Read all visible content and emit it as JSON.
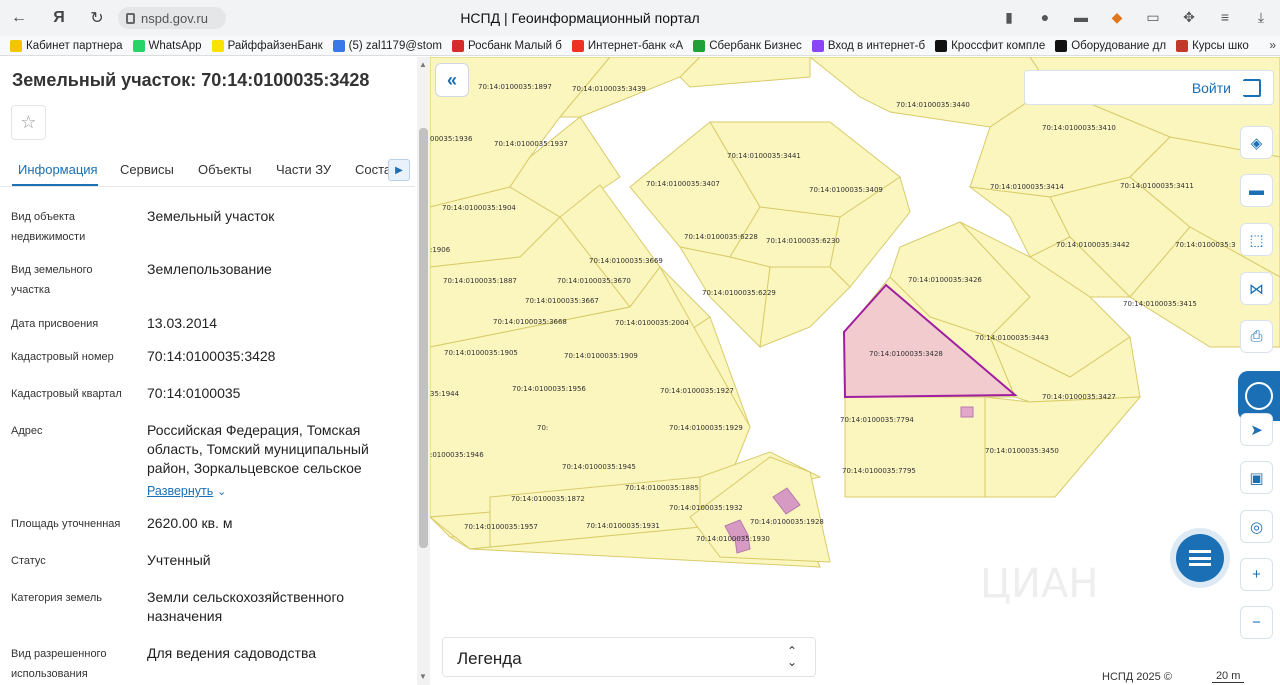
{
  "browser": {
    "url": "nspd.gov.ru",
    "page_title": "НСПД | Геоинформационный портал",
    "bookmarks": [
      {
        "label": "Кабинет партнера",
        "color": "#f4c400"
      },
      {
        "label": "WhatsApp",
        "color": "#25d366"
      },
      {
        "label": "РайффайзенБанк",
        "color": "#f9e100"
      },
      {
        "label": "(5) zal1179@stom",
        "color": "#3b78e7"
      },
      {
        "label": "Росбанк Малый б",
        "color": "#d62b2b"
      },
      {
        "label": "Интернет-банк «А",
        "color": "#ef3124"
      },
      {
        "label": "Сбербанк Бизнес",
        "color": "#21a038"
      },
      {
        "label": "Вход в интернет-б",
        "color": "#8b44f7"
      },
      {
        "label": "Кроссфит компле",
        "color": "#111111"
      },
      {
        "label": "Оборудование дл",
        "color": "#111111"
      },
      {
        "label": "Курсы шко",
        "color": "#c0392b"
      }
    ]
  },
  "panel": {
    "title": "Земельный участок: 70:14:0100035:3428",
    "tabs": [
      "Информация",
      "Сервисы",
      "Объекты",
      "Части ЗУ",
      "Соста"
    ],
    "rows": [
      {
        "label": "Вид объекта недвижимости",
        "value": "Земельный участок"
      },
      {
        "label": "Вид земельного участка",
        "value": "Землепользование"
      },
      {
        "label": "Дата присвоения",
        "value": "13.03.2014"
      },
      {
        "label": "Кадастровый номер",
        "value": "70:14:0100035:3428"
      },
      {
        "label": "Кадастровый квартал",
        "value": "70:14:0100035"
      },
      {
        "label": "Адрес",
        "value": "Российская Федерация, Томская область, Томский муниципальный район, Зоркальцевское сельское"
      },
      {
        "label": "Площадь уточненная",
        "value": "2620.00 кв. м"
      },
      {
        "label": "Статус",
        "value": "Учтенный"
      },
      {
        "label": "Категория земель",
        "value": "Земли сельскохозяйственного назначения"
      },
      {
        "label": "Вид разрешенного использования",
        "value": "Для ведения садоводства"
      }
    ],
    "expand_label": "Развернуть"
  },
  "map": {
    "login_label": "Войти",
    "legend_label": "Легенда",
    "copyright": "НСПД 2025 ©",
    "scale": "20 m",
    "selected_parcel": "70:14:0100035:3428",
    "parcel_labels": [
      "70:14:0100035:1897",
      "70:14:0100035:3439",
      "70:14:0100035:3440",
      "70:14:0100035:3410",
      "00035:1936",
      "70:14:0100035:1937",
      "70:14:0100035:3441",
      "70:14:0100035:3407",
      "70:14:0100035:3409",
      "70:14:0100035:3414",
      "70:14:0100035:3411",
      "70:14:0100035:1904",
      "70:14:0100035:6228",
      "70:14:0100035:6230",
      "70:14:0100035:3442",
      "70:14:0100035:3",
      ":1906",
      "70:14:0100035:3669",
      "70:14:0100035:3670",
      "70:14:0100035:1887",
      "70:14:0100035:6229",
      "70:14:0100035:3426",
      "70:14:0100035:3415",
      "70:14:0100035:3667",
      "70:14:0100035:3668",
      "70:14:0100035:2004",
      "70:14:0100035:3443",
      "70:14:0100035:1905",
      "70:14:0100035:1909",
      "70:14:0100035:3428",
      "35:1944",
      "70:14:0100035:1956",
      "70:14:0100035:1927",
      "70:14:0100035:3427",
      "70:",
      "70:14:0100035:1929",
      "70:14:0100035:7794",
      ":0100035:1946",
      "70:14:0100035:1945",
      "70:14:0100035:3450",
      "70:14:0100035:1885",
      "70:14:0100035:7795",
      "70:14:0100035:1872",
      "70:14:0100035:1932",
      "70:14:0100035:1928",
      "70:14:0100035:1957",
      "70:14:0100035:1931",
      "70:14:0100035:1930"
    ]
  }
}
